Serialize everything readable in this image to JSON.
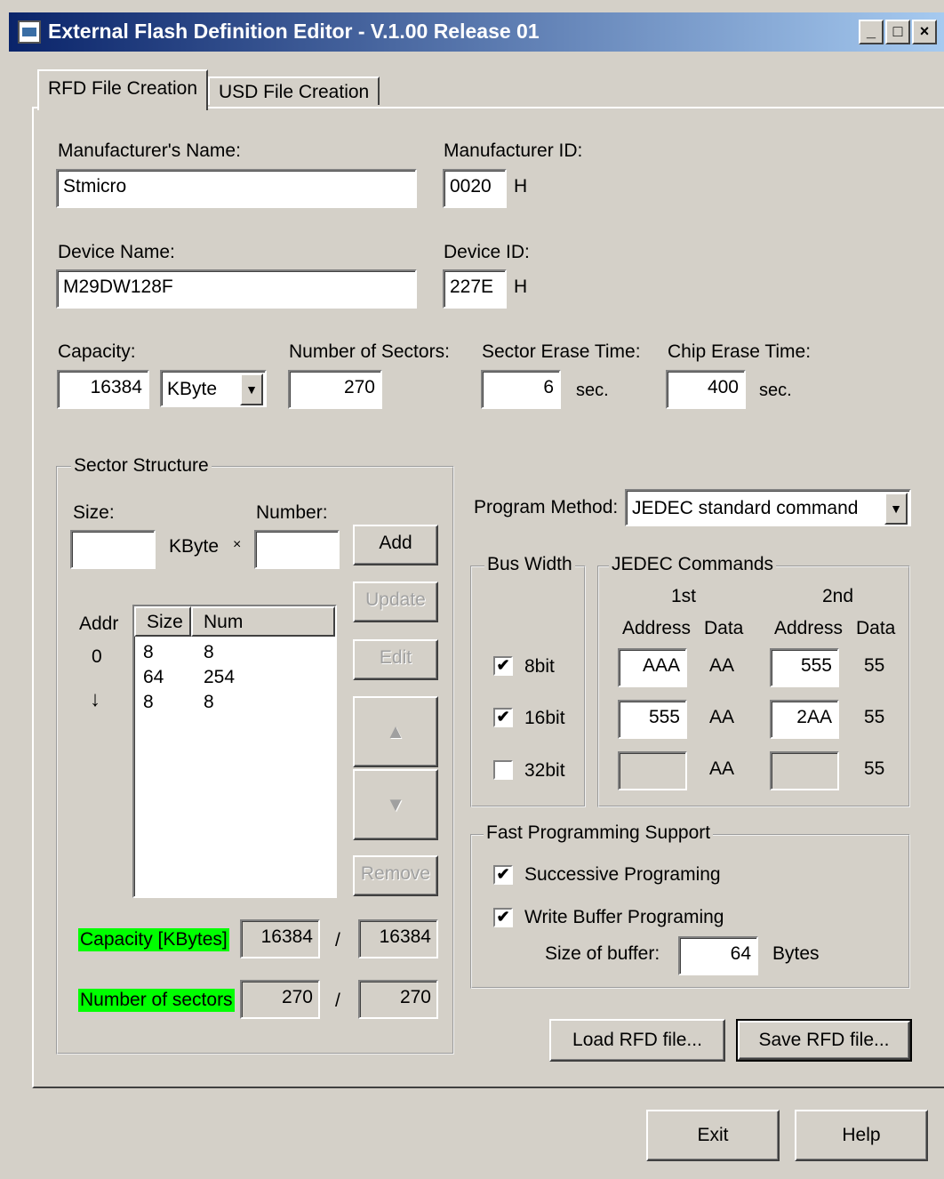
{
  "window": {
    "title": "External Flash Definition Editor - V.1.00 Release 01"
  },
  "tabs": [
    {
      "label": "RFD File Creation"
    },
    {
      "label": "USD File Creation"
    }
  ],
  "manufacturer": {
    "name_label": "Manufacturer's Name:",
    "name_value": "Stmicro",
    "id_label": "Manufacturer ID:",
    "id_value": "0020",
    "id_unit": "H"
  },
  "device": {
    "name_label": "Device Name:",
    "name_value": "M29DW128F",
    "id_label": "Device ID:",
    "id_value": "227E",
    "id_unit": "H"
  },
  "capacity": {
    "label": "Capacity:",
    "value": "16384",
    "unit_selected": "KByte"
  },
  "sectors": {
    "label": "Number of Sectors:",
    "value": "270"
  },
  "sector_erase": {
    "label": "Sector Erase Time:",
    "value": "6",
    "unit": "sec."
  },
  "chip_erase": {
    "label": "Chip Erase Time:",
    "value": "400",
    "unit": "sec."
  },
  "sector_structure": {
    "title": "Sector Structure",
    "size_label": "Size:",
    "size_unit": "KByte",
    "times": "×",
    "number_label": "Number:",
    "add": "Add",
    "update": "Update",
    "edit": "Edit",
    "remove": "Remove",
    "addr_label": "Addr",
    "addr_start": "0",
    "addr_arrow": "↓",
    "columns": [
      "Size",
      "Num"
    ],
    "rows": [
      {
        "size": "8",
        "num": "8"
      },
      {
        "size": "64",
        "num": "254"
      },
      {
        "size": "8",
        "num": "8"
      }
    ],
    "capacity_label": "Capacity [KBytes]",
    "capacity_value": "16384",
    "capacity_total": "16384",
    "sectors_label": "Number of sectors",
    "sectors_value": "270",
    "sectors_total": "270",
    "slash": "/"
  },
  "program_method": {
    "label": "Program Method:",
    "selected": "JEDEC standard command"
  },
  "bus_width": {
    "title": "Bus Width",
    "options": [
      {
        "label": "8bit",
        "checked": true
      },
      {
        "label": "16bit",
        "checked": true
      },
      {
        "label": "32bit",
        "checked": false
      }
    ]
  },
  "jedec": {
    "title": "JEDEC Commands",
    "first": "1st",
    "second": "2nd",
    "address": "Address",
    "data": "Data",
    "rows": [
      {
        "addr1": "AAA",
        "data1": "AA",
        "addr2": "555",
        "data2": "55"
      },
      {
        "addr1": "555",
        "data1": "AA",
        "addr2": "2AA",
        "data2": "55"
      },
      {
        "addr1": "",
        "data1": "AA",
        "addr2": "",
        "data2": "55"
      }
    ]
  },
  "fast_programming": {
    "title": "Fast Programming Support",
    "successive": {
      "label": "Successive Programing",
      "checked": true
    },
    "write_buffer": {
      "label": "Write Buffer Programing",
      "checked": true
    },
    "buffer_label": "Size of buffer:",
    "buffer_value": "64",
    "buffer_unit": "Bytes"
  },
  "buttons": {
    "load": "Load RFD file...",
    "save": "Save RFD file...",
    "exit": "Exit",
    "help": "Help"
  },
  "icons": {
    "up": "▲",
    "down": "▼",
    "check": "✔",
    "dropdown": "▼"
  }
}
